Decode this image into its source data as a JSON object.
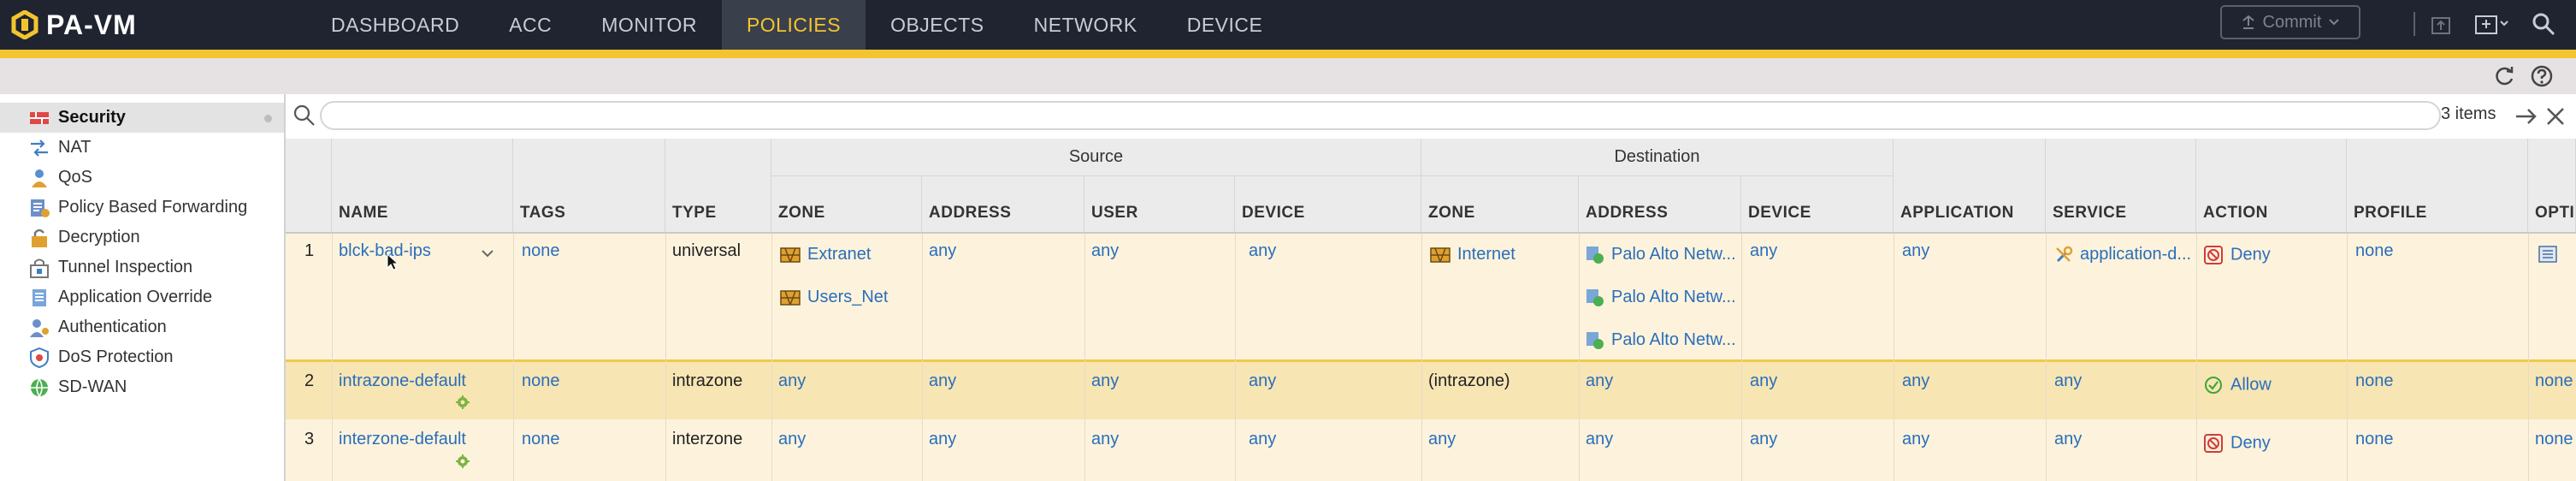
{
  "app": {
    "logo_text": "PA-VM",
    "tabs": [
      "DASHBOARD",
      "ACC",
      "MONITOR",
      "POLICIES",
      "OBJECTS",
      "NETWORK",
      "DEVICE"
    ],
    "active_tab": "POLICIES",
    "commit_label": "Commit",
    "accent_color": "#f4c430",
    "nav_bg_color": "#1f2430"
  },
  "sidebar": {
    "items": [
      {
        "label": "Security",
        "icon": "security-rules-icon",
        "active": true
      },
      {
        "label": "NAT",
        "icon": "nat-icon"
      },
      {
        "label": "QoS",
        "icon": "qos-icon"
      },
      {
        "label": "Policy Based Forwarding",
        "icon": "pbf-icon"
      },
      {
        "label": "Decryption",
        "icon": "decryption-lock-icon"
      },
      {
        "label": "Tunnel Inspection",
        "icon": "tunnel-icon"
      },
      {
        "label": "Application Override",
        "icon": "app-override-icon"
      },
      {
        "label": "Authentication",
        "icon": "authentication-icon"
      },
      {
        "label": "DoS Protection",
        "icon": "dos-icon"
      },
      {
        "label": "SD-WAN",
        "icon": "sdwan-icon"
      }
    ]
  },
  "search": {
    "placeholder": "",
    "count_text": "3 items"
  },
  "table": {
    "groups": {
      "source": "Source",
      "destination": "Destination"
    },
    "headers": {
      "num": "",
      "name": "NAME",
      "tags": "TAGS",
      "type": "TYPE",
      "src_zone": "ZONE",
      "src_address": "ADDRESS",
      "src_user": "USER",
      "src_device": "DEVICE",
      "dst_zone": "ZONE",
      "dst_address": "ADDRESS",
      "dst_device": "DEVICE",
      "application": "APPLICATION",
      "service": "SERVICE",
      "action": "ACTION",
      "profile": "PROFILE",
      "options": "OPTIONS"
    },
    "rows": [
      {
        "num": "1",
        "name": "blck-bad-ips",
        "tags": "none",
        "type": "universal",
        "src_zone": [
          "Extranet",
          "Users_Net"
        ],
        "src_address": "any",
        "src_user": "any",
        "src_device": "any",
        "dst_zone": "Internet",
        "dst_address": [
          "Palo Alto Netw...",
          "Palo Alto Netw...",
          "Palo Alto Netw..."
        ],
        "dst_device": "any",
        "application": "any",
        "service": "application-d...",
        "action": "Deny",
        "profile": "none",
        "options": ""
      },
      {
        "num": "2",
        "name": "intrazone-default",
        "tags": "none",
        "type": "intrazone",
        "src_zone": "any",
        "src_address": "any",
        "src_user": "any",
        "src_device": "any",
        "dst_zone": "(intrazone)",
        "dst_address": "any",
        "dst_device": "any",
        "application": "any",
        "service": "any",
        "action": "Allow",
        "profile": "none",
        "options": "none"
      },
      {
        "num": "3",
        "name": "interzone-default",
        "tags": "none",
        "type": "interzone",
        "src_zone": "any",
        "src_address": "any",
        "src_user": "any",
        "src_device": "any",
        "dst_zone": "any",
        "dst_address": "any",
        "dst_device": "any",
        "application": "any",
        "service": "any",
        "action": "Deny",
        "profile": "none",
        "options": "none"
      }
    ],
    "colors": {
      "row1_bg": "#fdf3dc",
      "row2_bg": "#f7e5b4",
      "row3_bg": "#fdf3dc",
      "link": "#2a6ebb",
      "deny": "#d23b3b",
      "allow": "#3fa535"
    }
  }
}
